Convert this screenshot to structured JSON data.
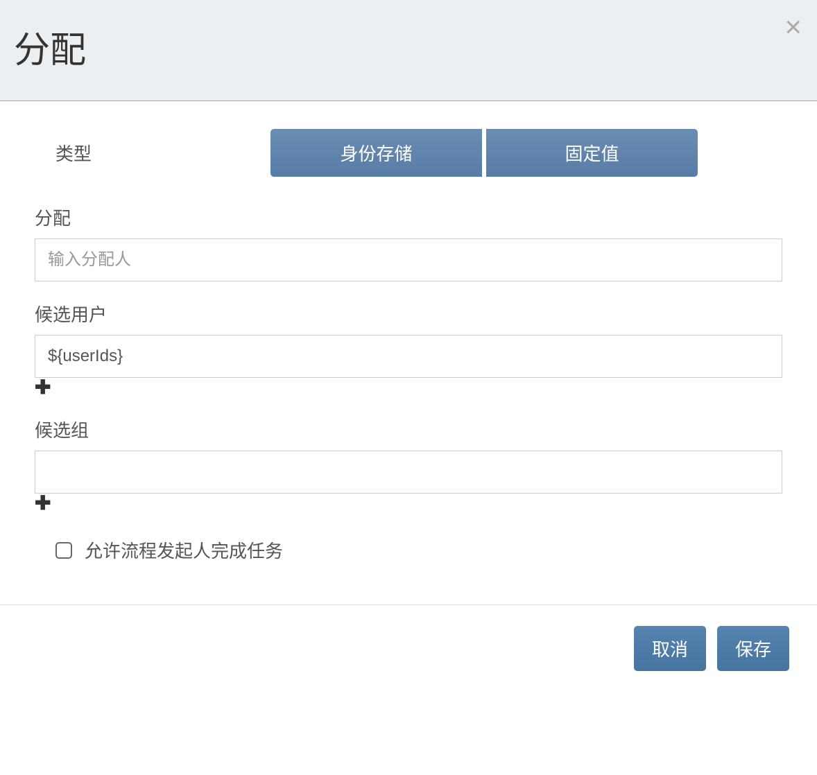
{
  "modal": {
    "title": "分配",
    "type_label": "类型",
    "type_options": {
      "identity_store": "身份存储",
      "fixed_value": "固定值"
    },
    "assignee": {
      "label": "分配",
      "placeholder": "输入分配人",
      "value": ""
    },
    "candidate_users": {
      "label": "候选用户",
      "value": "${userIds}"
    },
    "candidate_groups": {
      "label": "候选组",
      "value": ""
    },
    "allow_initiator": {
      "label": "允许流程发起人完成任务",
      "checked": false
    },
    "footer": {
      "cancel": "取消",
      "save": "保存"
    }
  }
}
